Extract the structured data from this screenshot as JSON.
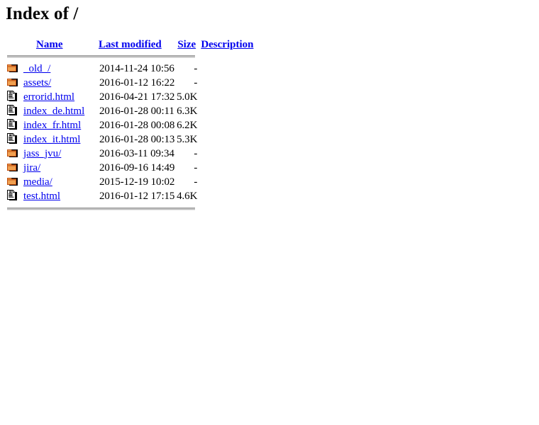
{
  "page": {
    "title": "Index of /"
  },
  "colors": {
    "link": "#0000EE",
    "folder_icon": "#F0A050",
    "folder_icon_outline": "#C05010",
    "rule": "#BDBDBD",
    "text": "#000000",
    "background": "#FFFFFF"
  },
  "table": {
    "headers": [
      {
        "label": "Name",
        "name": "sort-by-name"
      },
      {
        "label": "Last modified",
        "name": "sort-by-last-modified"
      },
      {
        "label": "Size",
        "name": "sort-by-size"
      },
      {
        "label": "Description",
        "name": "sort-by-description"
      }
    ],
    "rows": [
      {
        "icon": "folder-icon",
        "name": "_old_/",
        "last_modified": "2014-11-24 10:56",
        "size": "-",
        "description": ""
      },
      {
        "icon": "folder-icon",
        "name": "assets/",
        "last_modified": "2016-01-12 16:22",
        "size": "-",
        "description": ""
      },
      {
        "icon": "file-icon",
        "name": "errorid.html",
        "last_modified": "2016-04-21 17:32",
        "size": "5.0K",
        "description": ""
      },
      {
        "icon": "file-icon",
        "name": "index_de.html",
        "last_modified": "2016-01-28 00:11",
        "size": "6.3K",
        "description": ""
      },
      {
        "icon": "file-icon",
        "name": "index_fr.html",
        "last_modified": "2016-01-28 00:08",
        "size": "6.2K",
        "description": ""
      },
      {
        "icon": "file-icon",
        "name": "index_it.html",
        "last_modified": "2016-01-28 00:13",
        "size": "5.3K",
        "description": ""
      },
      {
        "icon": "folder-icon",
        "name": "jass_jvu/",
        "last_modified": "2016-03-11 09:34",
        "size": "-",
        "description": ""
      },
      {
        "icon": "folder-icon",
        "name": "jira/",
        "last_modified": "2016-09-16 14:49",
        "size": "-",
        "description": ""
      },
      {
        "icon": "folder-icon",
        "name": "media/",
        "last_modified": "2015-12-19 10:02",
        "size": "-",
        "description": ""
      },
      {
        "icon": "file-icon",
        "name": "test.html",
        "last_modified": "2016-01-12 17:15",
        "size": "4.6K",
        "description": ""
      }
    ]
  }
}
